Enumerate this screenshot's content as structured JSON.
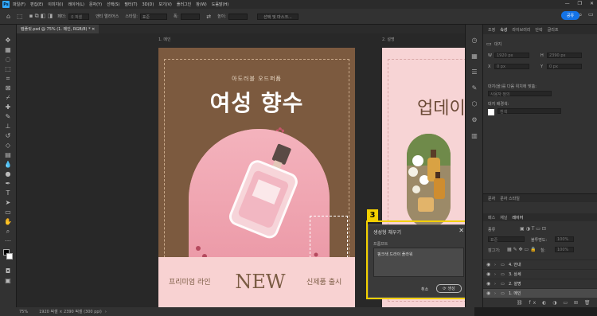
{
  "menubar": {
    "logo": "Ps",
    "items": [
      "파일(F)",
      "편집(E)",
      "이미지(I)",
      "레이어(L)",
      "문자(Y)",
      "선택(S)",
      "필터(T)",
      "3D(D)",
      "보기(V)",
      "플러그인",
      "창(W)",
      "도움말(H)"
    ],
    "window_controls": [
      "—",
      "❐",
      "✕"
    ]
  },
  "options": {
    "share_label": "공유",
    "feather_label": "페더:",
    "feather_value": "0 픽셀",
    "antialias_label": "앤티 앨리어스",
    "style_label": "스타일:",
    "style_value": "표준",
    "width_label": "폭:",
    "height_label": "높이:",
    "select_mask_label": "선택 및 마스크..."
  },
  "document_tab": {
    "label": "템플릿.psd @ 75% (1. 메인, RGB/8) * ✕"
  },
  "status": {
    "zoom": "75%",
    "info": "1920 픽셀 × 2390 픽셀 (300 ppi)"
  },
  "artboard1": {
    "label": "1. 메인",
    "subtitle": "아도러블 오드퍼퓸",
    "title": "여성 향수",
    "left_band": "프리미엄 라인",
    "center_band": "NEW",
    "right_band": "신제품 출시"
  },
  "artboard2": {
    "label": "2. 설명",
    "title": "업데이"
  },
  "dialog": {
    "badge": "3",
    "title": "생성형 채우기",
    "close": "✕",
    "prompt_label": "프롬프트",
    "prompt_value": "핑크색 드라이 플라워",
    "cancel_label": "취소",
    "generate_label": "생성"
  },
  "properties": {
    "tabs": [
      "조정",
      "속성",
      "라이브러리",
      "단락",
      "글리프"
    ],
    "active_tab": "속성",
    "kind": "대지",
    "w_label": "W",
    "h_label": "H",
    "x_label": "X",
    "y_label": "Y",
    "w_value": "1920 px",
    "h_value": "2390 px",
    "x_value": "0 px",
    "y_value": "0 px",
    "preset_label": "대지(을)를 다음 위치에 맞춤:",
    "preset_value": "사용자 정의",
    "bg_label": "대지 배경색:",
    "bg_value": "흰색"
  },
  "layers": {
    "tabs": [
      "문자",
      "문자 스타일"
    ],
    "sub_tabs": [
      "패스",
      "채널",
      "레이어"
    ],
    "kind_label": "종류",
    "mode_value": "표준",
    "opacity_label": "불투명도:",
    "opacity_value": "100%",
    "lock_label": "잠그기:",
    "fill_label": "칠:",
    "fill_value": "100%",
    "items": [
      {
        "name": "4. 안내",
        "selected": false
      },
      {
        "name": "3. 상세",
        "selected": false
      },
      {
        "name": "2. 설명",
        "selected": false
      },
      {
        "name": "1. 메인",
        "selected": true
      }
    ]
  },
  "colors": {
    "brown": "#7c5a3f",
    "pink": "#f8d2d2",
    "highlight": "#f3d000",
    "accent": "#1473e6"
  }
}
